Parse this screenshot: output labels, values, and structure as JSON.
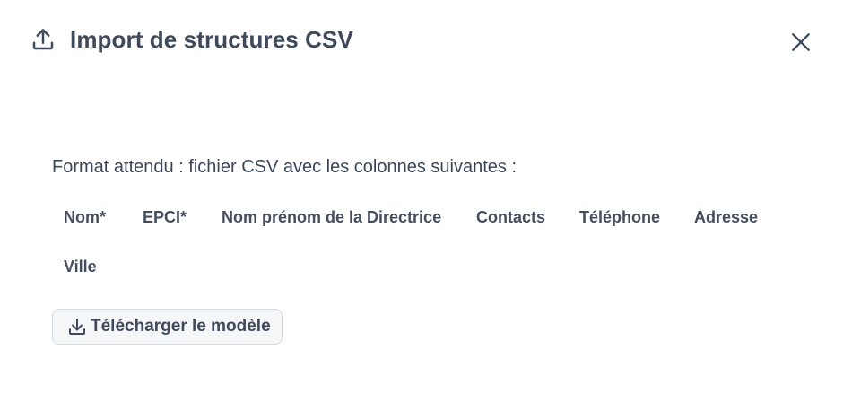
{
  "dialog": {
    "title": "Import de structures CSV",
    "header_icon": "upload-icon",
    "close_icon": "close-icon"
  },
  "content": {
    "description": "Format attendu : fichier CSV avec les colonnes suivantes :",
    "columns": [
      "Nom*",
      "EPCI*",
      "Nom prénom de la Directrice",
      "Contacts",
      "Téléphone",
      "Adresse",
      "Ville"
    ],
    "download_button": {
      "label": "Télécharger le modèle",
      "icon": "download-icon"
    }
  },
  "colors": {
    "text": "#3b4658",
    "button_bg": "#f5f6f7",
    "button_border": "#d6d9de"
  }
}
